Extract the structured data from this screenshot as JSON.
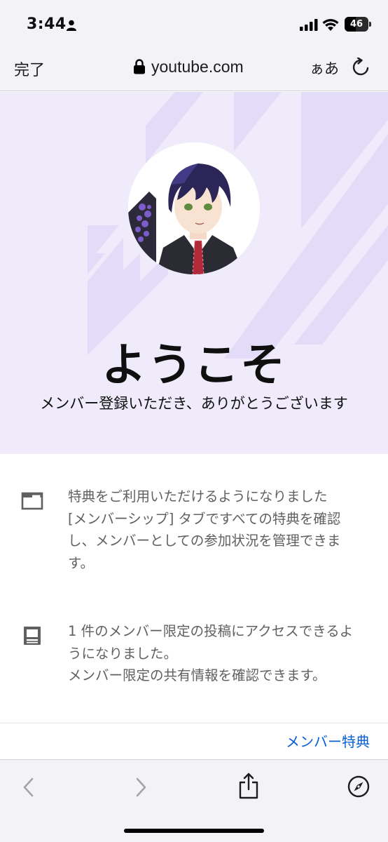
{
  "status_bar": {
    "time": "3:44",
    "battery_percent": "46",
    "battery_level": 0.46,
    "icons": [
      "person-icon",
      "signal-icon",
      "wifi-icon",
      "battery-icon"
    ]
  },
  "browser": {
    "done_label": "完了",
    "url": "youtube.com",
    "text_size_label": "ぁあ",
    "icons": [
      "lock-icon",
      "reload-icon"
    ]
  },
  "hero": {
    "title": "ようこそ",
    "subtitle": "メンバー登録いただき、ありがとうございます",
    "background_color": "#efebfb",
    "stripe_color": "#e2daf8"
  },
  "benefits": [
    {
      "icon": "window-icon",
      "line1": "特典をご利用いただけるようになりました",
      "line2": "[メンバーシップ] タブですべての特典を確認",
      "line3": "し、メンバーとしての参加状況を管理できま",
      "line4": "す。"
    },
    {
      "icon": "post-icon",
      "line1": "1 件のメンバー限定の投稿にアクセスできるよ",
      "line2": "うになりました。",
      "line3": "メンバー限定の共有情報を確認できます。"
    }
  ],
  "footer": {
    "member_benefits_link": "メンバー特典",
    "link_color": "#065fd4"
  },
  "toolbar": {
    "icons": [
      "back-icon",
      "forward-icon",
      "share-icon",
      "compass-icon"
    ]
  }
}
